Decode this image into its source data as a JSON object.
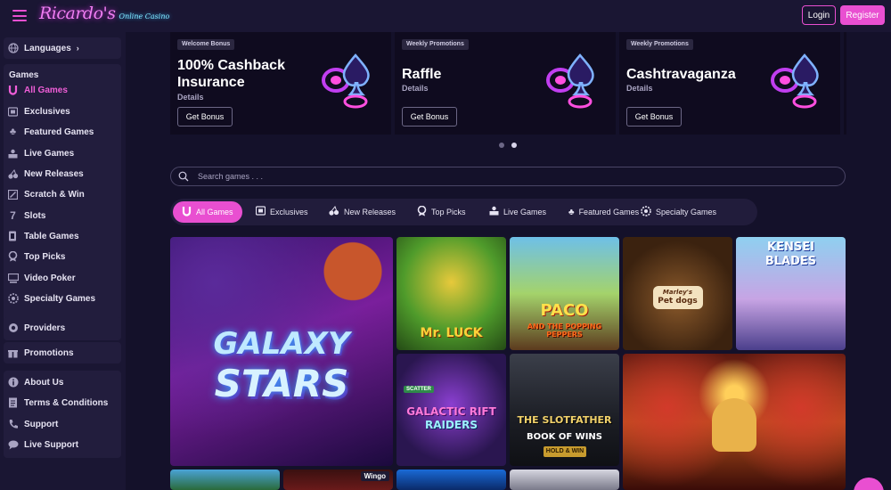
{
  "header": {
    "logo_main": "Ricardo's",
    "logo_sub": "Online Casino",
    "login_label": "Login",
    "register_label": "Register"
  },
  "sidebar": {
    "languages_label": "Languages",
    "games_heading": "Games",
    "games": [
      {
        "label": "All Games",
        "icon": "horseshoe-icon",
        "active": true
      },
      {
        "label": "Exclusives",
        "icon": "exclusives-icon"
      },
      {
        "label": "Featured Games",
        "icon": "clover-icon"
      },
      {
        "label": "Live Games",
        "icon": "live-dealer-icon"
      },
      {
        "label": "New Releases",
        "icon": "cherries-icon"
      },
      {
        "label": "Scratch & Win",
        "icon": "scratch-icon"
      },
      {
        "label": "Slots",
        "icon": "seven-icon"
      },
      {
        "label": "Table Games",
        "icon": "cards-icon"
      },
      {
        "label": "Top Picks",
        "icon": "trophy-icon"
      },
      {
        "label": "Video Poker",
        "icon": "video-poker-icon"
      },
      {
        "label": "Specialty Games",
        "icon": "wheel-icon"
      }
    ],
    "providers_label": "Providers",
    "promotions_label": "Promotions",
    "info": [
      {
        "label": "About Us",
        "icon": "info-icon"
      },
      {
        "label": "Terms & Conditions",
        "icon": "document-icon"
      },
      {
        "label": "Support",
        "icon": "phone-icon"
      },
      {
        "label": "Live Support",
        "icon": "chat-bubble-icon"
      }
    ]
  },
  "promos": [
    {
      "badge": "Welcome Bonus",
      "title_line1": "100% Cashback",
      "title_line2": "Insurance",
      "details": "Details",
      "button": "Get Bonus"
    },
    {
      "badge": "Weekly Promotions",
      "title_line1": "Raffle",
      "title_line2": "",
      "details": "Details",
      "button": "Get Bonus"
    },
    {
      "badge": "Weekly Promotions",
      "title_line1": "Cashtravaganza",
      "title_line2": "",
      "details": "Details",
      "button": "Get Bonus"
    }
  ],
  "carousel": {
    "pages": 2,
    "current": 2
  },
  "search": {
    "placeholder": "Search games . . ."
  },
  "tabs": [
    {
      "label": "All Games",
      "icon": "horseshoe-icon",
      "active": true
    },
    {
      "label": "Exclusives",
      "icon": "exclusives-icon"
    },
    {
      "label": "New Releases",
      "icon": "cherries-icon"
    },
    {
      "label": "Top Picks",
      "icon": "trophy-icon"
    },
    {
      "label": "Live Games",
      "icon": "live-dealer-icon"
    },
    {
      "label": "Featured Games",
      "icon": "clover-icon"
    },
    {
      "label": "Specialty Games",
      "icon": "wheel-icon"
    }
  ],
  "games": [
    {
      "title_line1": "GALAXY",
      "title_line2": "STARS"
    },
    {
      "title_line1": "Mr. LUCK",
      "title_line2": ""
    },
    {
      "title_line1": "PACO",
      "title_line2": "AND THE POPPING PEPPERS"
    },
    {
      "title_line1": "Marley's",
      "title_line2": "Pet dogs"
    },
    {
      "title_line1": "KENSEI",
      "title_line2": "BLADES"
    },
    {
      "title_line1": "GALACTIC RIFT",
      "title_line2": "RAIDERS",
      "tag": "SCATTER"
    },
    {
      "title_line1": "THE SLOTFATHER",
      "title_line2": "BOOK OF WINS",
      "tag": "HOLD & WIN"
    },
    {
      "title_line1": "",
      "title_line2": ""
    },
    {
      "title_line1": "",
      "title_line2": ""
    },
    {
      "title_line1": "",
      "title_line2": "",
      "tag": "Wingo"
    },
    {
      "title_line1": "",
      "title_line2": ""
    },
    {
      "title_line1": "",
      "title_line2": ""
    }
  ],
  "colors": {
    "accent": "#e94fd1",
    "background": "#14112a",
    "sidebar": "#1a1633"
  }
}
